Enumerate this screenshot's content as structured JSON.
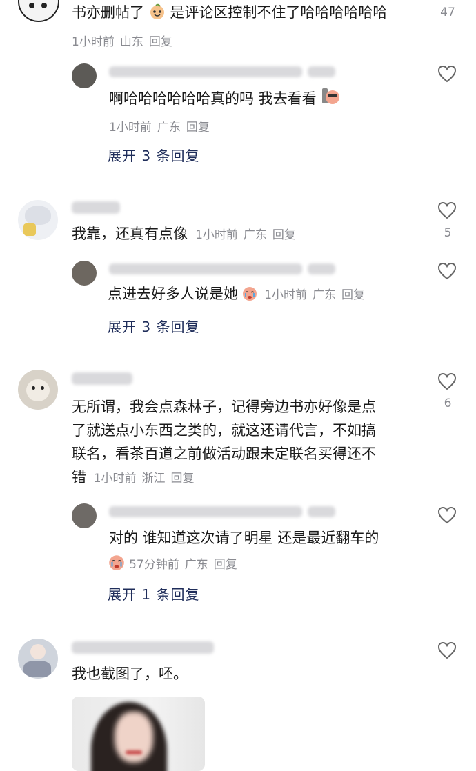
{
  "comments": [
    {
      "text": "书亦删帖了",
      "text_after_emoji": "是评论区控制不住了哈哈哈哈哈哈",
      "time": "1小时前",
      "location": "山东",
      "reply_label": "回复",
      "likes": "47",
      "reply": {
        "text": "啊哈哈哈哈哈哈真的吗 我去看看",
        "time": "1小时前",
        "location": "广东",
        "reply_label": "回复"
      },
      "expand": "展开 3 条回复"
    },
    {
      "text": "我靠，还真有点像",
      "time": "1小时前",
      "location": "广东",
      "reply_label": "回复",
      "likes": "5",
      "reply": {
        "text": "点进去好多人说是她",
        "time": "1小时前",
        "location": "广东",
        "reply_label": "回复"
      },
      "expand": "展开 3 条回复"
    },
    {
      "text_lines": [
        "无所谓，我会点森林子，记得旁边书亦好像是点",
        "了就送点小东西之类的，就这还请代言，不如搞",
        "联名，看茶百道之前做活动跟未定联名买得还不",
        "错"
      ],
      "time": "1小时前",
      "location": "浙江",
      "reply_label": "回复",
      "likes": "6",
      "reply": {
        "text": "对的 谁知道这次请了明星 还是最近翻车的",
        "time": "57分钟前",
        "location": "广东",
        "reply_label": "回复"
      },
      "expand": "展开 1 条回复"
    },
    {
      "text": "我也截图了，呸。"
    }
  ],
  "icons": {
    "like": "heart-outline-icon",
    "emoji_peach_smile": "peach-emoji-icon",
    "emoji_cry": "crying-emoji-icon"
  },
  "colors": {
    "meta": "#8a8b91",
    "expand": "#1f2d5a",
    "emoji": "#f3a58f"
  }
}
